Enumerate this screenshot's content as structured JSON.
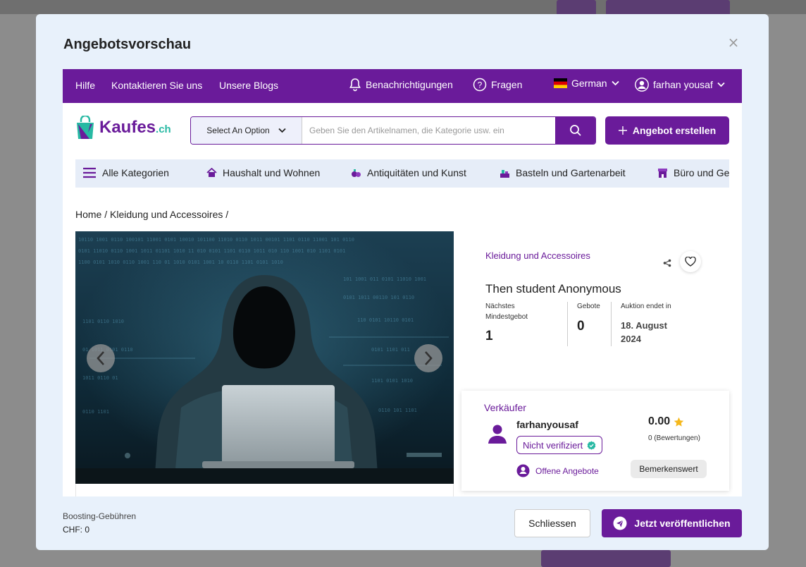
{
  "modal": {
    "title": "Angebotsvorschau",
    "close_icon": "close-icon"
  },
  "topbar": {
    "links": [
      "Hilfe",
      "Kontaktieren Sie uns",
      "Unsere Blogs"
    ],
    "notifications": "Benachrichtigungen",
    "questions": "Fragen",
    "language": "German",
    "user": "farhan yousaf"
  },
  "header": {
    "logo_main": "Kaufes",
    "logo_suffix": ".ch",
    "search_select": "Select An Option",
    "search_placeholder": "Geben Sie den Artikelnamen, die Kategorie usw. ein",
    "add_button": "Angebot erstellen"
  },
  "categories": [
    "Alle Kategorien",
    "Haushalt und Wohnen",
    "Antiquitäten und Kunst",
    "Basteln und Gartenarbeit",
    "Büro und Ge"
  ],
  "breadcrumb": {
    "home": "Home",
    "current": "Kleidung und Accessoires"
  },
  "product": {
    "category": "Kleidung und Accessoires",
    "title": "Then student Anonymous",
    "min_bid_label_1": "Nächstes",
    "min_bid_label_2": "Mindestgebot",
    "min_bid_value": "1",
    "bids_label": "Gebote",
    "bids_value": "0",
    "ends_label": "Auktion endet in",
    "ends_date_1": "18. August",
    "ends_date_2": "2024"
  },
  "seller": {
    "heading": "Verkäufer",
    "name": "farhanyousaf",
    "badge": "Nicht verifiziert",
    "rating": "0.00",
    "reviews": "0 (Bewertungen)",
    "open_offers": "Offene Angebote",
    "note": "Bemerkenswert"
  },
  "footer": {
    "fee_label": "Boosting-Gebühren",
    "fee_value": "CHF: 0",
    "close_button": "Schliessen",
    "publish_button": "Jetzt veröffentlichen"
  },
  "colors": {
    "brand": "#6a1b9a",
    "accent": "#27b9a3",
    "modal_bg": "#e8f1fb"
  }
}
